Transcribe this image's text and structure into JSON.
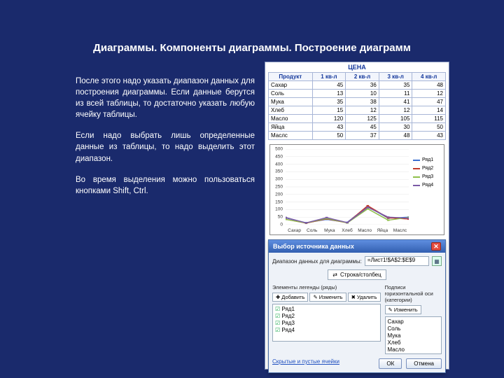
{
  "title": "Диаграммы. Компоненты диаграммы. Построение диаграмм",
  "paragraphs": [
    "После этого надо указать диапазон данных для построения диаграммы. Если данные берутся из всей таблицы, то достаточно указать любую ячейку таблицы.",
    "Если надо выбрать лишь определенные данные из таблицы, то надо выделить этот диапазон.",
    "Во время выделения можно пользоваться кнопками Shift, Ctrl."
  ],
  "table": {
    "header_title": "ЦЕНА",
    "columns": [
      "Продукт",
      "1 кв-л",
      "2 кв-л",
      "3 кв-л",
      "4 кв-л"
    ],
    "rows": [
      [
        "Сахар",
        45,
        36,
        35,
        48
      ],
      [
        "Соль",
        13,
        10,
        11,
        12
      ],
      [
        "Мука",
        35,
        38,
        41,
        47
      ],
      [
        "Хлеб",
        15,
        12,
        12,
        14
      ],
      [
        "Масло",
        120,
        125,
        105,
        115
      ],
      [
        "Яйца",
        43,
        45,
        30,
        50
      ],
      [
        "Маслс",
        50,
        37,
        48,
        43
      ]
    ]
  },
  "chart_data": {
    "type": "line",
    "categories": [
      "Сахар",
      "Соль",
      "Мука",
      "Хлеб",
      "Масло",
      "Яйца",
      "Маслс"
    ],
    "series": [
      {
        "name": "Ряд1",
        "color": "#3b6fd1",
        "values": [
          45,
          13,
          35,
          15,
          120,
          43,
          50
        ]
      },
      {
        "name": "Ряд2",
        "color": "#c0392b",
        "values": [
          36,
          10,
          38,
          12,
          125,
          45,
          37
        ]
      },
      {
        "name": "Ряд3",
        "color": "#8fbf4a",
        "values": [
          35,
          11,
          41,
          12,
          105,
          30,
          48
        ]
      },
      {
        "name": "Ряд4",
        "color": "#7b5aa6",
        "values": [
          48,
          12,
          47,
          14,
          115,
          50,
          43
        ]
      }
    ],
    "ylim": [
      0,
      500
    ],
    "yticks": [
      0,
      50,
      100,
      150,
      200,
      250,
      300,
      350,
      400,
      450,
      500
    ],
    "title": "",
    "xlabel": "",
    "ylabel": ""
  },
  "dialog": {
    "title": "Выбор источника данных",
    "range_label": "Диапазон данных для диаграммы:",
    "range_value": "=Лист1!$A$2:$E$9",
    "swap_label": "Строка/столбец",
    "left_panel_label": "Элементы легенды (ряды)",
    "right_panel_label": "Подписи горизонтальной оси (категории)",
    "btn_add": "Добавить",
    "btn_edit": "Изменить",
    "btn_remove": "Удалить",
    "btn_edit2": "Изменить",
    "series_list": [
      "Ряд1",
      "Ряд2",
      "Ряд3",
      "Ряд4"
    ],
    "category_list": [
      "Сахар",
      "Соль",
      "Мука",
      "Хлеб",
      "Масло"
    ],
    "hidden_link": "Скрытые и пустые ячейки",
    "ok": "ОК",
    "cancel": "Отмена"
  }
}
